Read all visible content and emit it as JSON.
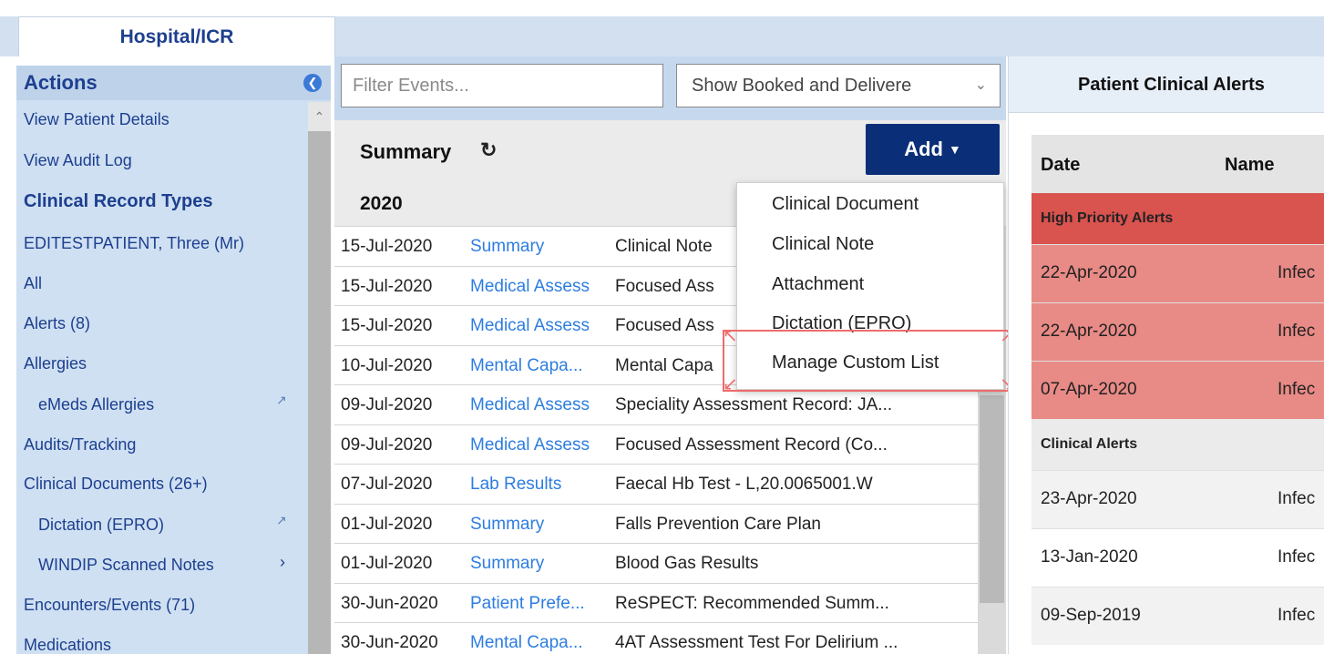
{
  "top_tab": {
    "label": "Hospital/ICR"
  },
  "sidebar": {
    "title": "Actions",
    "items": [
      {
        "label": "View Patient Details"
      },
      {
        "label": "View Audit Log"
      },
      {
        "label": "Clinical Record Types"
      },
      {
        "label": "EDITESTPATIENT, Three (Mr)"
      },
      {
        "label": "All"
      },
      {
        "label": "Alerts (8)"
      },
      {
        "label": "Allergies"
      },
      {
        "label": "eMeds Allergies"
      },
      {
        "label": "Audits/Tracking"
      },
      {
        "label": "Clinical Documents (26+)"
      },
      {
        "label": "Dictation (EPRO)"
      },
      {
        "label": "WINDIP Scanned Notes"
      },
      {
        "label": "Encounters/Events (71)"
      },
      {
        "label": "Medications"
      }
    ],
    "icons": {
      "collapse": "collapse-left-icon",
      "external": "external-link-icon",
      "chevron": "chevron-right-icon"
    }
  },
  "events_panel": {
    "filter_placeholder": "Filter Events...",
    "show_select_value": "Show Booked and Delivere",
    "summary_title": "Summary",
    "add_button_label": "Add",
    "year": "2020",
    "rows": [
      {
        "date": "15-Jul-2020",
        "type": "Summary",
        "desc": "Clinical Note"
      },
      {
        "date": "15-Jul-2020",
        "type": "Medical Assess",
        "desc": "Focused Ass"
      },
      {
        "date": "15-Jul-2020",
        "type": "Medical Assess",
        "desc": "Focused Ass"
      },
      {
        "date": "10-Jul-2020",
        "type": "Mental Capa...",
        "desc": "Mental Capa"
      },
      {
        "date": "09-Jul-2020",
        "type": "Medical Assess",
        "desc": "Speciality Assessment Record: JA..."
      },
      {
        "date": "09-Jul-2020",
        "type": "Medical Assess",
        "desc": "Focused Assessment Record (Co..."
      },
      {
        "date": "07-Jul-2020",
        "type": "Lab Results",
        "desc": "Faecal Hb Test - L,20.0065001.W"
      },
      {
        "date": "01-Jul-2020",
        "type": "Summary",
        "desc": "Falls Prevention Care Plan"
      },
      {
        "date": "01-Jul-2020",
        "type": "Summary",
        "desc": "Blood Gas Results"
      },
      {
        "date": "30-Jun-2020",
        "type": "Patient Prefe...",
        "desc": "ReSPECT: Recommended Summ..."
      },
      {
        "date": "30-Jun-2020",
        "type": "Mental Capa...",
        "desc": "4AT Assessment Test For Delirium ..."
      }
    ]
  },
  "add_menu": {
    "items": [
      {
        "label": "Clinical Document"
      },
      {
        "label": "Clinical Note"
      },
      {
        "label": "Attachment"
      },
      {
        "label": "Dictation (EPRO)"
      },
      {
        "label": "Manage Custom List"
      }
    ]
  },
  "alerts_panel": {
    "title": "Patient Clinical Alerts",
    "col_date": "Date",
    "col_name": "Name",
    "high_priority_label": "High Priority Alerts",
    "high_priority_rows": [
      {
        "date": "22-Apr-2020",
        "name": "Infec"
      },
      {
        "date": "22-Apr-2020",
        "name": "Infec"
      },
      {
        "date": "07-Apr-2020",
        "name": "Infec"
      }
    ],
    "clinical_label": "Clinical Alerts",
    "clinical_rows": [
      {
        "date": "23-Apr-2020",
        "name": "Infec"
      },
      {
        "date": "13-Jan-2020",
        "name": "Infec"
      },
      {
        "date": "09-Sep-2019",
        "name": "Infec"
      }
    ],
    "colors": {
      "high_priority_header": "#d9534f",
      "high_priority_row": "#e88a86",
      "link_blue": "#2d7de0",
      "nav_blue": "#0a2f78"
    }
  }
}
